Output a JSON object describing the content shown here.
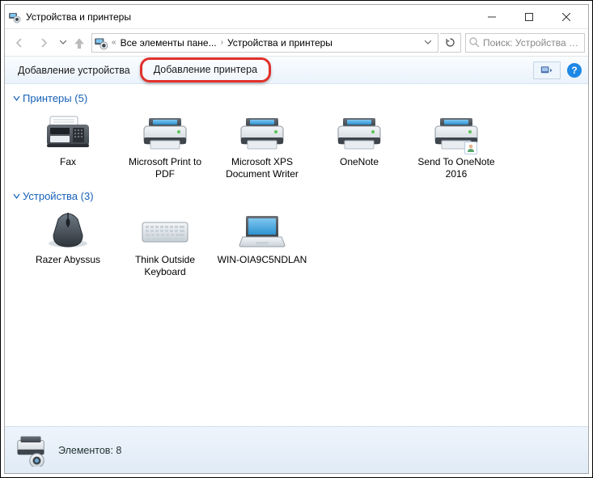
{
  "window": {
    "title": "Устройства и принтеры"
  },
  "breadcrumbs": {
    "prefix": "«",
    "part1": "Все элементы пане...",
    "part2": "Устройства и принтеры"
  },
  "search": {
    "placeholder": "Поиск: Устройства и..."
  },
  "toolbar": {
    "add_device": "Добавление устройства",
    "add_printer": "Добавление принтера"
  },
  "groups": {
    "printers": {
      "title": "Принтеры",
      "count": "(5)"
    },
    "devices": {
      "title": "Устройства",
      "count": "(3)"
    }
  },
  "printers": [
    {
      "label": "Fax",
      "icon": "fax"
    },
    {
      "label": "Microsoft Print to PDF",
      "icon": "printer"
    },
    {
      "label": "Microsoft XPS Document Writer",
      "icon": "printer"
    },
    {
      "label": "OneNote",
      "icon": "printer"
    },
    {
      "label": "Send To OneNote 2016",
      "icon": "printer",
      "badge": true
    }
  ],
  "devices": [
    {
      "label": "Razer Abyssus",
      "icon": "mouse"
    },
    {
      "label": "Think Outside Keyboard",
      "icon": "keyboard"
    },
    {
      "label": "WIN-OIA9C5NDLAN",
      "icon": "laptop"
    }
  ],
  "status": {
    "text": "Элементов: 8"
  }
}
